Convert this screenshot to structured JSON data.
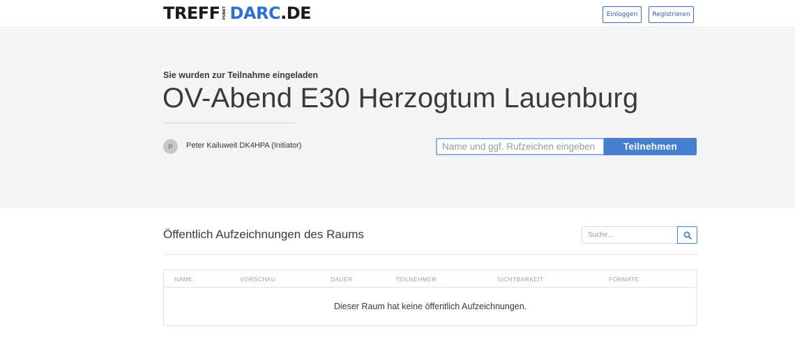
{
  "header": {
    "logo": {
      "part1": "TREFF",
      "punkt": "PUNKT",
      "part2_d": "D",
      "part2": "ARC",
      "part3": ".DE"
    },
    "login_label": "Einloggen",
    "register_label": "Registrieren"
  },
  "hero": {
    "invited_label": "Sie wurden zur Teilnahme eingeladen",
    "room_title": "OV-Abend E30 Herzogtum Lauenburg",
    "avatar_initial": "P",
    "initiator": "Peter Kailuweit DK4HPA (Initiator)",
    "join_placeholder": "Name und ggf. Rufzeichen eingeben",
    "join_value": "",
    "join_button": "Teilnehmen"
  },
  "recordings": {
    "title": "Öffentlich Aufzeichnungen des Raums",
    "search_placeholder": "Suche...",
    "search_icon": "search-icon",
    "columns": [
      "Name",
      "Vorschau",
      "Dauer",
      "Teilnehmer",
      "Sichtbarkeit",
      "Formate"
    ],
    "empty_message": "Dieser Raum hat keine öffentlich Aufzeichnungen."
  },
  "colors": {
    "accent": "#467fcf",
    "hero_bg": "#f5f5f5",
    "logo_blue": "#2f6fd1"
  }
}
